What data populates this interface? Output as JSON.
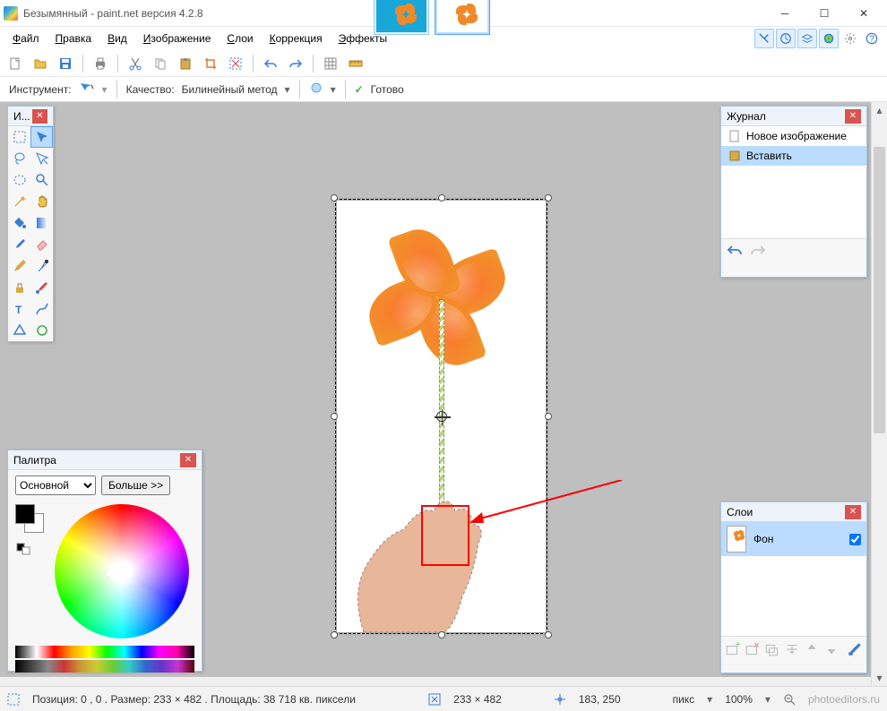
{
  "title": "Безымянный - paint.net версия 4.2.8",
  "menus": [
    "Файл",
    "Правка",
    "Вид",
    "Изображение",
    "Слои",
    "Коррекция",
    "Эффекты"
  ],
  "optbar": {
    "tool_label": "Инструмент:",
    "quality_label": "Качество:",
    "quality_value": "Билинейный метод",
    "status": "Готово"
  },
  "tools_panel": {
    "title": "И..."
  },
  "history_panel": {
    "title": "Журнал",
    "items": [
      {
        "label": "Новое изображение",
        "sel": false
      },
      {
        "label": "Вставить",
        "sel": true
      }
    ]
  },
  "layers_panel": {
    "title": "Слои",
    "items": [
      {
        "label": "Фон",
        "checked": true
      }
    ]
  },
  "palette_panel": {
    "title": "Палитра",
    "mode": "Основной",
    "more": "Больше >>"
  },
  "statusbar": {
    "pos_size": "Позиция: 0 , 0 . Размер: 233  × 482 . Площадь: 38 718 кв. пиксели",
    "dim": "233 × 482",
    "cursor": "183, 250",
    "unit": "пикс",
    "zoom": "100%"
  },
  "watermark": "photoeditors.ru"
}
